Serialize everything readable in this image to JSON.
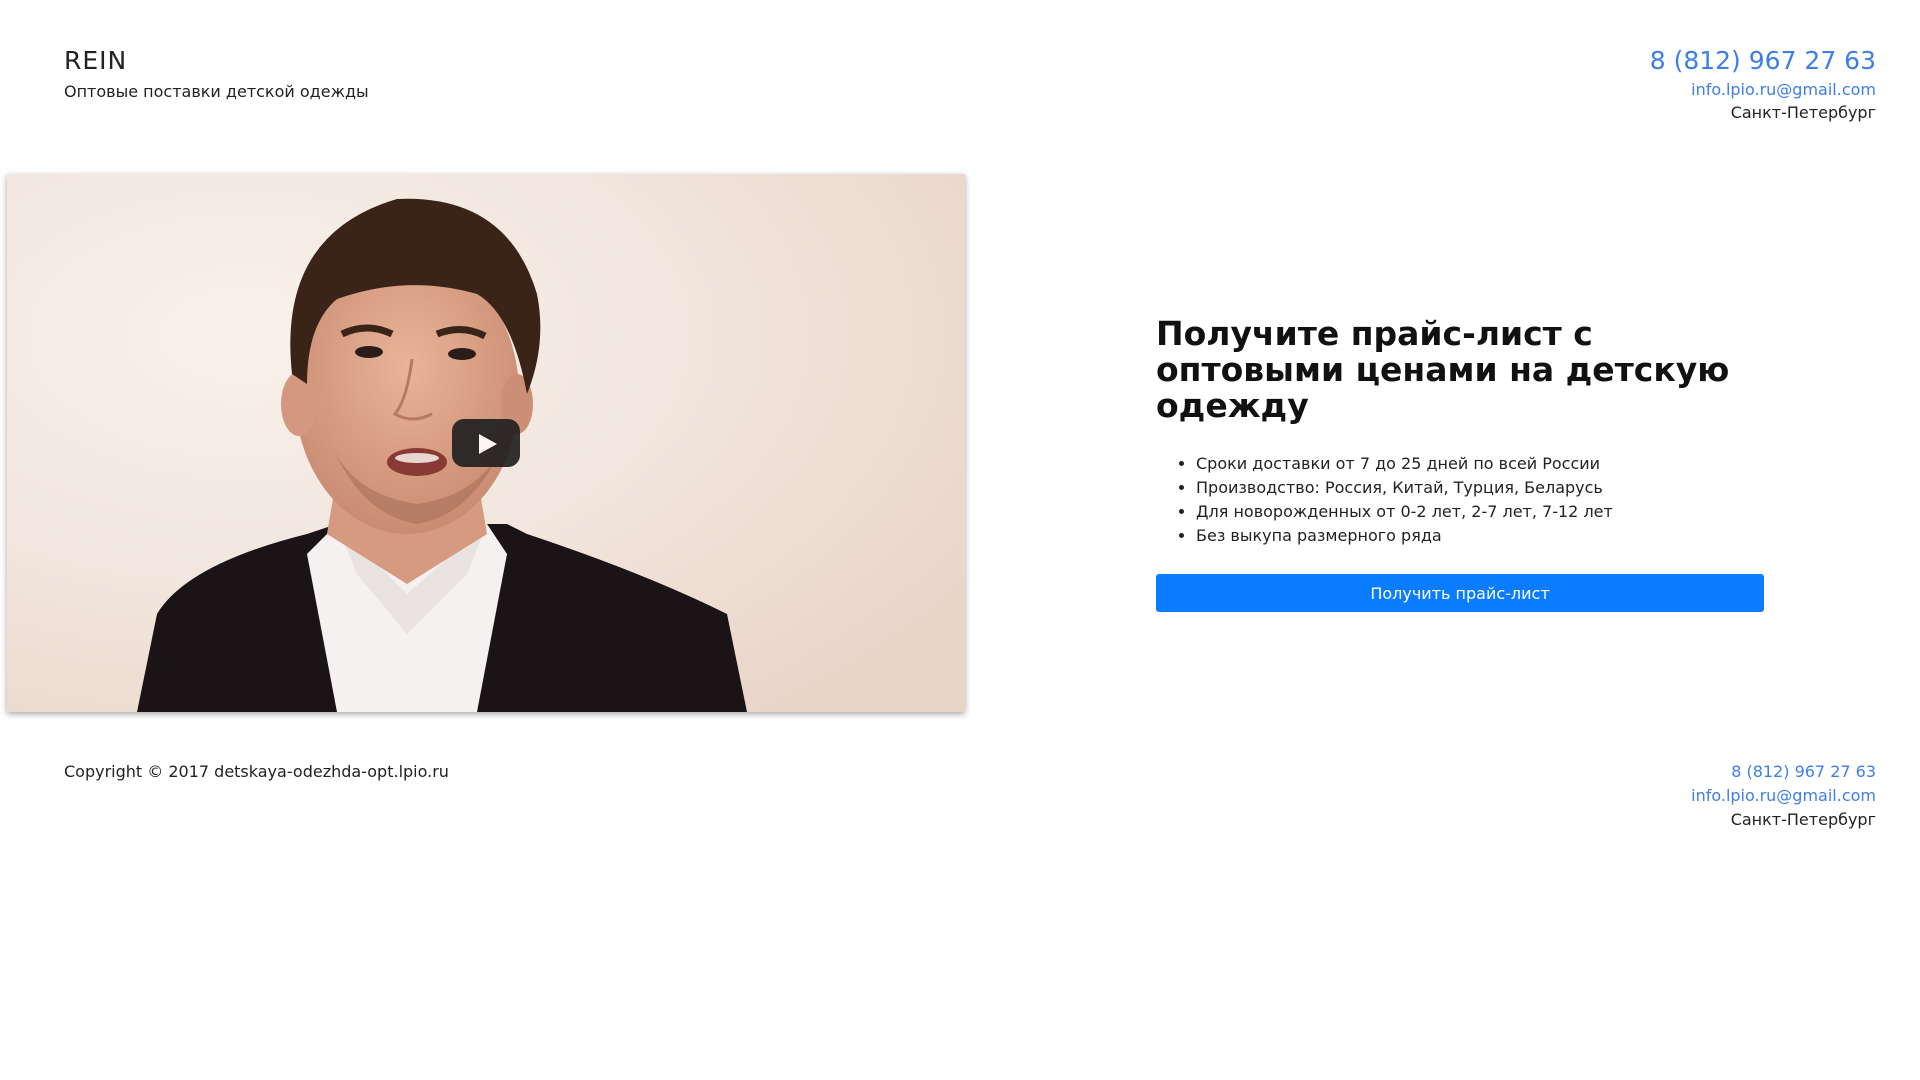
{
  "header": {
    "brand_name": "REIN",
    "tagline": "Оптовые поставки детской одежды",
    "phone": "8 (812) 967 27 63",
    "email": "info.lpio.ru@gmail.com",
    "city": "Санкт-Петербург"
  },
  "video": {
    "play_icon": "play-icon"
  },
  "offer": {
    "title": "Получите прайс-лист с оптовыми ценами на детскую одежду",
    "features": [
      "Сроки доставки от 7 до 25 дней по всей России",
      "Производство: Россия, Китай, Турция, Беларусь",
      "Для новорожденных от 0-2 лет, 2-7 лет, 7-12 лет",
      "Без выкупа размерного ряда"
    ],
    "button_label": "Получить прайс-лист"
  },
  "footer": {
    "copyright": "Copyright © 2017 detskaya-odezhda-opt.lpio.ru",
    "phone": "8 (812) 967 27 63",
    "email": "info.lpio.ru@gmail.com",
    "city": "Санкт-Петербург"
  },
  "colors": {
    "link": "#3d7ee8",
    "button": "#0a7cff"
  }
}
